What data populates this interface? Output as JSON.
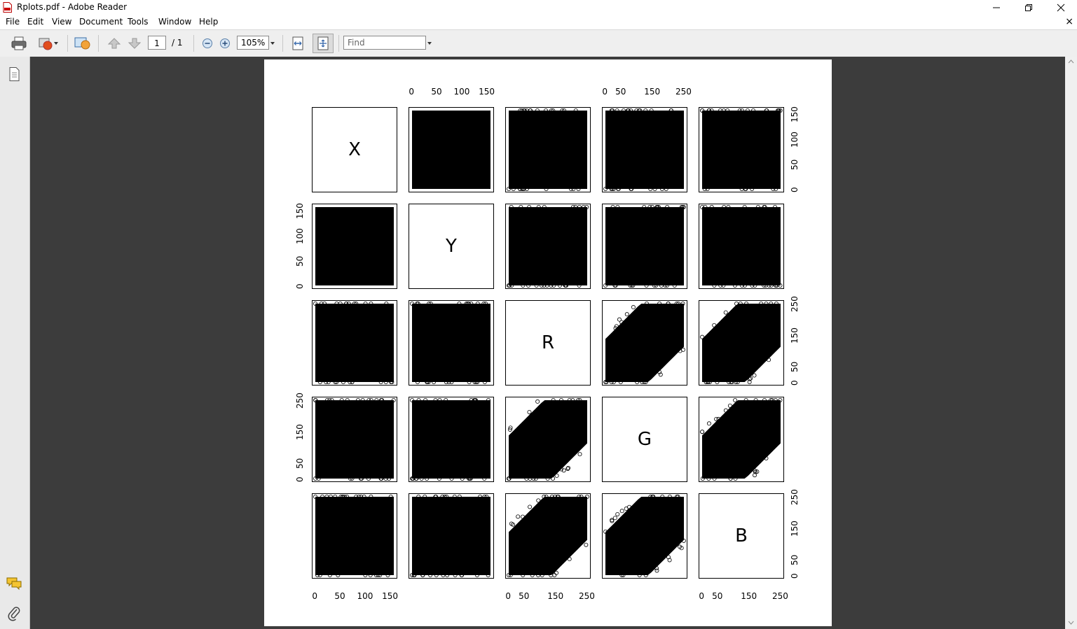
{
  "window": {
    "title": "Rplots.pdf - Adobe Reader"
  },
  "menu": [
    "File",
    "Edit",
    "View",
    "Document",
    "Tools",
    "Window",
    "Help"
  ],
  "toolbar": {
    "page_current": "1",
    "page_total": "/ 1",
    "zoom": "105%",
    "find_placeholder": "Find"
  },
  "colors": {
    "viewport_bg": "#3c3c3c",
    "page_bg": "#ffffff",
    "ink": "#000000"
  },
  "chart_data": {
    "type": "scatter",
    "matrix": "pairs",
    "variables": [
      "X",
      "Y",
      "R",
      "G",
      "B"
    ],
    "ranges": {
      "X": [
        0,
        160
      ],
      "Y": [
        0,
        160
      ],
      "R": [
        0,
        255
      ],
      "G": [
        0,
        255
      ],
      "B": [
        0,
        255
      ]
    },
    "ticks": {
      "X": [
        "0",
        "50",
        "100",
        "150"
      ],
      "Y": [
        "0",
        "50",
        "100",
        "150"
      ],
      "R": [
        "0",
        "50",
        "150",
        "250"
      ],
      "G": [
        "0",
        "50",
        "150",
        "250"
      ],
      "B": [
        "0",
        "50",
        "150",
        "250"
      ]
    },
    "grid": false
  }
}
